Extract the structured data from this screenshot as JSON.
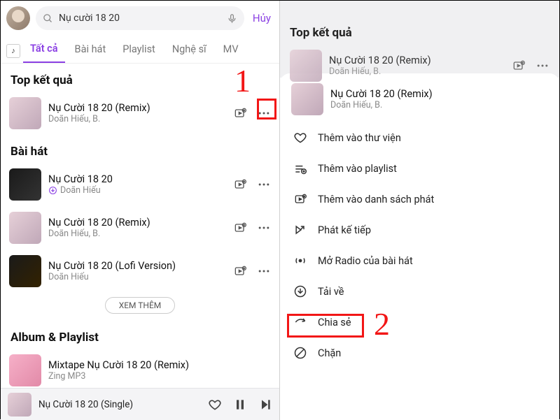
{
  "left": {
    "search": {
      "query": "Nụ cười 18 20",
      "cancel": "Hủy"
    },
    "tabs": [
      "Tất cả",
      "Bài hát",
      "Playlist",
      "Nghệ sĩ",
      "MV"
    ],
    "active_tab": 0,
    "top_results": {
      "heading": "Top kết quả",
      "item": {
        "title": "Nụ Cười 18 20 (Remix)",
        "artist": "Doãn Hiếu, B."
      }
    },
    "songs": {
      "heading": "Bài hát",
      "items": [
        {
          "title": "Nụ Cười 18 20",
          "artist": "Doãn Hiếu",
          "downloaded": true,
          "cover": "dark"
        },
        {
          "title": "Nụ Cười 18 20 (Remix)",
          "artist": "Doãn Hiếu, B.",
          "downloaded": false,
          "cover": ""
        },
        {
          "title": "Nụ Cười 18 20 (Lofi Version)",
          "artist": "Doãn Hiếu",
          "downloaded": false,
          "cover": "darkgold"
        }
      ],
      "see_more": "XEM THÊM"
    },
    "albums": {
      "heading": "Album & Playlist",
      "items": [
        {
          "title": "Mixtape Nụ Cười 18 20 (Remix)",
          "artist": "Zing MP3",
          "cover": "pink"
        }
      ]
    },
    "now_playing": {
      "title": "Nụ Cười 18 20 (Single)"
    },
    "annotation": "1"
  },
  "right": {
    "heading": "Top kết quả",
    "song": {
      "title": "Nụ Cười 18 20 (Remix)",
      "artist": "Doãn Hiếu, B."
    },
    "menu": [
      {
        "icon": "heart",
        "label": "Thêm vào thư viện"
      },
      {
        "icon": "playlist-add",
        "label": "Thêm vào playlist"
      },
      {
        "icon": "queue-add",
        "label": "Thêm vào danh sách phát"
      },
      {
        "icon": "play-next",
        "label": "Phát kế tiếp"
      },
      {
        "icon": "radio",
        "label": "Mở Radio của bài hát"
      },
      {
        "icon": "download",
        "label": "Tải về"
      },
      {
        "icon": "share",
        "label": "Chia sẻ"
      },
      {
        "icon": "block",
        "label": "Chặn"
      }
    ],
    "annotation": "2"
  }
}
